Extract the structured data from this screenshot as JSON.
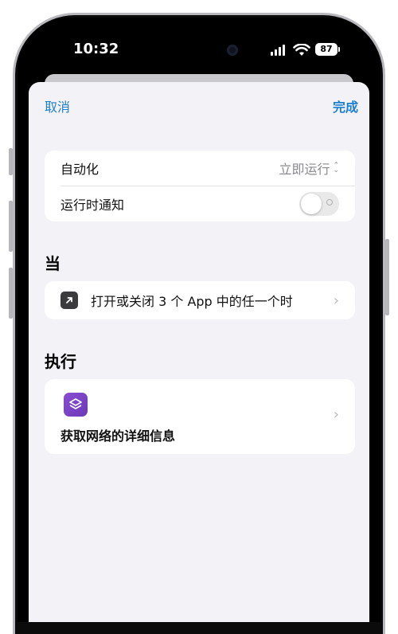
{
  "status_bar": {
    "time": "10:32",
    "battery": "87"
  },
  "nav": {
    "cancel_label": "取消",
    "done_label": "完成"
  },
  "settings": {
    "automation_label": "自动化",
    "automation_value": "立即运行",
    "notify_label": "运行时通知",
    "notify_enabled": false
  },
  "when_section": {
    "title": "当",
    "trigger_label": "打开或关闭 3 个 App 中的任一个时"
  },
  "do_section": {
    "title": "执行",
    "action_label": "获取网络的详细信息"
  },
  "colors": {
    "accent": "#1d7fd0",
    "background": "#f2f2f7",
    "shortcut_icon": "#7b45c9"
  },
  "icons": [
    "arrow-up-right-icon",
    "shortcuts-icon",
    "chevron-right-icon",
    "wifi-icon",
    "signal-icon",
    "battery-icon"
  ]
}
